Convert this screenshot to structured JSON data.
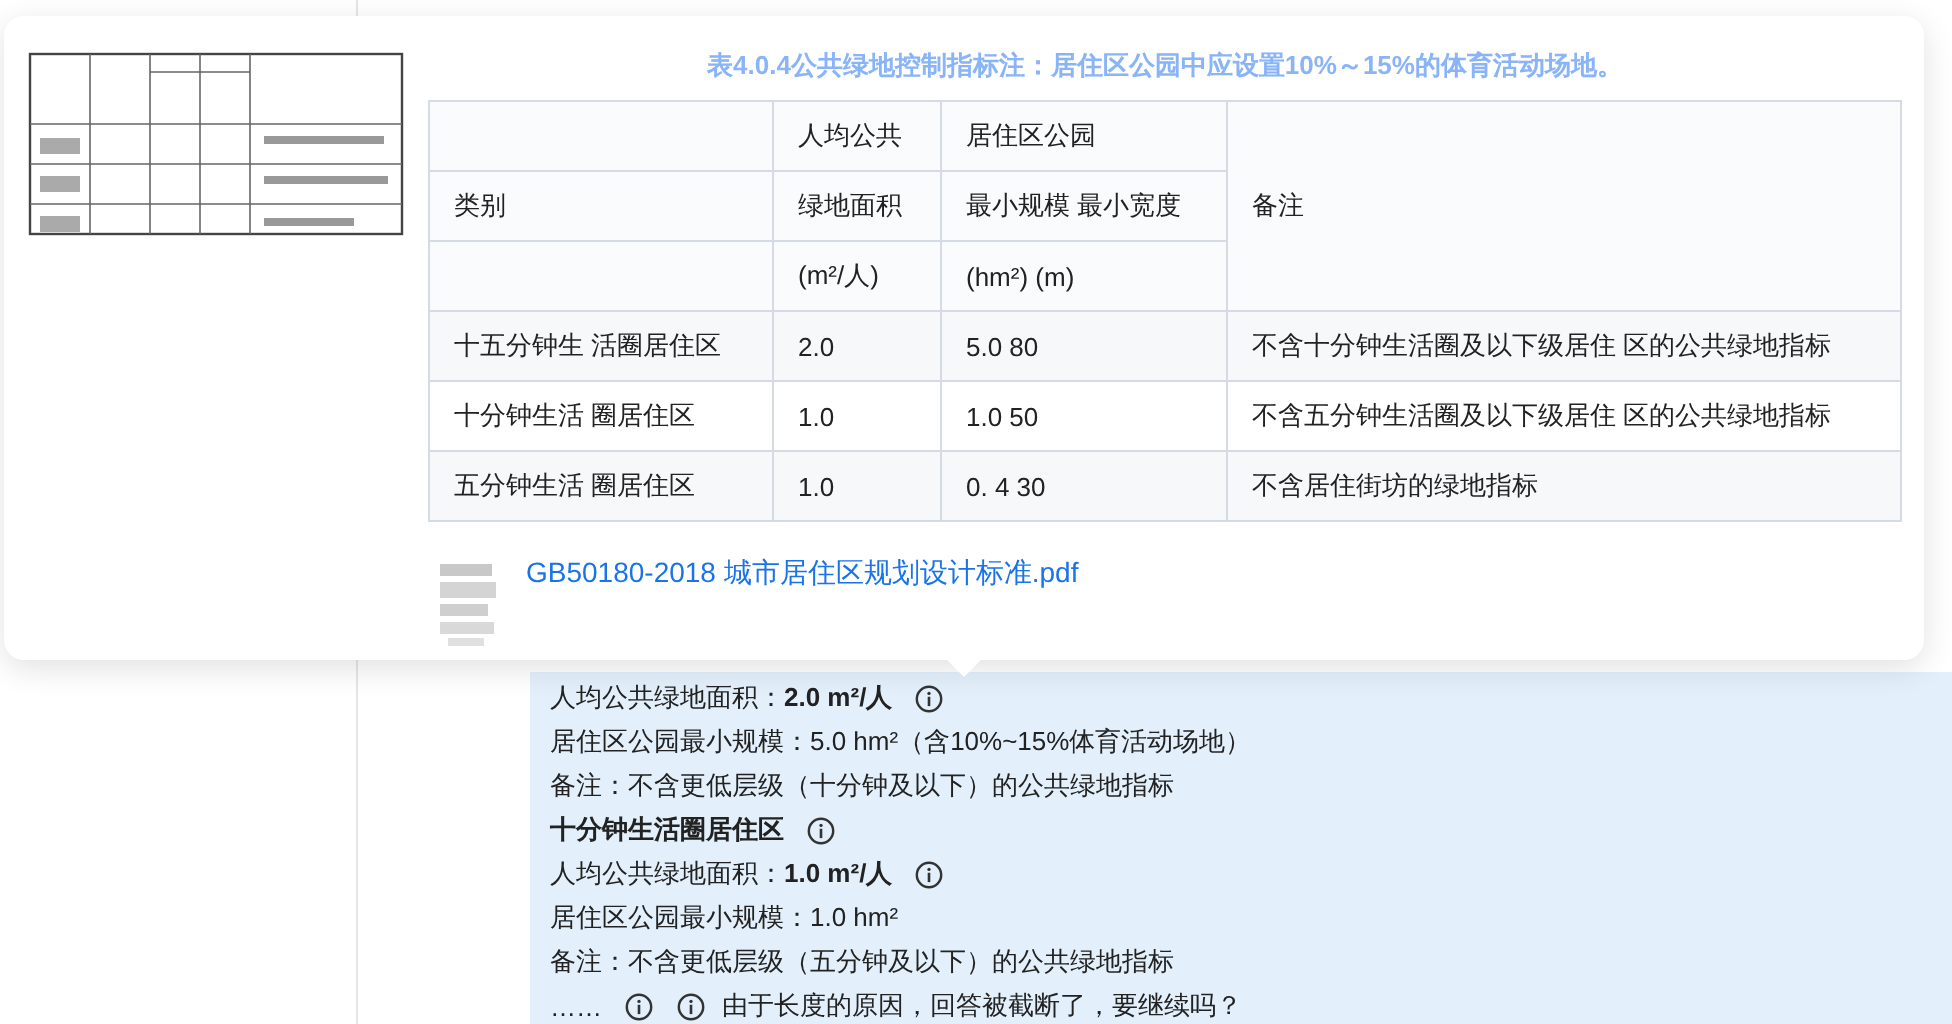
{
  "popup": {
    "title": "表4.0.4公共绿地控制指标注：居住区公园中应设置10%～15%的体育活动场地。",
    "table": {
      "header_rows": [
        [
          "",
          "人均公共",
          "居住区公园",
          "备注"
        ],
        [
          "类别",
          "绿地面积",
          "最小规模 最小宽度",
          ""
        ],
        [
          "",
          "(m²/人)",
          "(hm²) (m)",
          ""
        ]
      ],
      "rows": [
        [
          "十五分钟生 活圈居住区",
          "2.0",
          "5.0 80",
          "不含十分钟生活圈及以下级居住 区的公共绿地指标"
        ],
        [
          "十分钟生活 圈居住区",
          "1.0",
          "1.0 50",
          "不含五分钟生活圈及以下级居住 区的公共绿地指标"
        ],
        [
          "五分钟生活 圈居住区",
          "1.0",
          "0. 4 30",
          "不含居住街坊的绿地指标"
        ]
      ]
    },
    "attachment": {
      "name": "GB50180-2018 城市居住区规划设计标准.pdf"
    }
  },
  "message": {
    "lines": [
      {
        "kind": "text",
        "text": "人均公共绿地面积：**2.0 m²/人**",
        "info": true
      },
      {
        "kind": "text",
        "text": "居住区公园最小规模：5.0 hm²（含10%~15%体育活动场地）",
        "info": false
      },
      {
        "kind": "text",
        "text": "备注：不含更低层级（十分钟及以下）的公共绿地指标",
        "info": false
      },
      {
        "kind": "heading",
        "text": "十分钟生活圈居住区",
        "info": true
      },
      {
        "kind": "text",
        "text": "人均公共绿地面积：**1.0 m²/人**",
        "info": true
      },
      {
        "kind": "text",
        "text": "居住区公园最小规模：1.0 hm²",
        "info": false
      },
      {
        "kind": "text",
        "text": "备注：不含更低层级（五分钟及以下）的公共绿地指标",
        "info": false
      },
      {
        "kind": "truncation",
        "ellipsis": "……",
        "notice": "由于长度的原因，回答被截断了，要继续吗？",
        "info": true
      }
    ]
  }
}
